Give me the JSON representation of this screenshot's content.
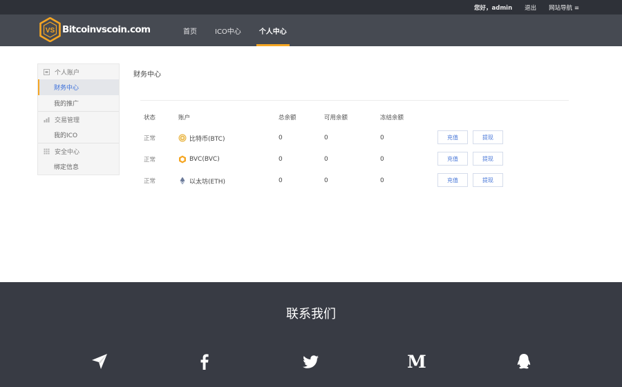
{
  "topbar": {
    "greeting": "您好，admin",
    "logout": "退出",
    "sitenav": "网站导航 ≡"
  },
  "brand": {
    "name": "Bitcoinvscoin.com",
    "mark": "VS"
  },
  "nav": [
    {
      "label": "首页"
    },
    {
      "label": "ICO中心"
    },
    {
      "label": "个人中心"
    }
  ],
  "sidebar": {
    "groups": [
      {
        "title": "个人账户",
        "icon": "account-icon",
        "items": [
          {
            "label": "财务中心",
            "active": true
          },
          {
            "label": "我的推广"
          }
        ]
      },
      {
        "title": "交易管理",
        "icon": "chart-icon",
        "items": [
          {
            "label": "我的ICO"
          }
        ]
      },
      {
        "title": "安全中心",
        "icon": "grid-icon",
        "items": [
          {
            "label": "绑定信息"
          }
        ]
      }
    ]
  },
  "main": {
    "title": "财务中心",
    "columns": {
      "status": "状态",
      "account": "账户",
      "total": "总余额",
      "available": "可用余额",
      "frozen": "冻结余额"
    },
    "rows": [
      {
        "status": "正常",
        "account": "比特币(BTC)",
        "icon": "btc-coin-icon",
        "total": "0",
        "available": "0",
        "frozen": "0",
        "recharge": "充值",
        "withdraw": "提现"
      },
      {
        "status": "正常",
        "account": "BVC(BVC)",
        "icon": "bvc-coin-icon",
        "total": "0",
        "available": "0",
        "frozen": "0",
        "recharge": "充值",
        "withdraw": "提现"
      },
      {
        "status": "正常",
        "account": "以太坊(ETH)",
        "icon": "eth-coin-icon",
        "total": "0",
        "available": "0",
        "frozen": "0",
        "recharge": "充值",
        "withdraw": "提现"
      }
    ]
  },
  "footer": {
    "title": "联系我们",
    "social": [
      "telegram-icon",
      "facebook-icon",
      "twitter-icon",
      "medium-icon",
      "qq-icon"
    ]
  },
  "colors": {
    "accent": "#f5a623",
    "link": "#3a6fdb",
    "header": "#464a52",
    "topbar": "#2e3138",
    "footer": "#383b44"
  }
}
